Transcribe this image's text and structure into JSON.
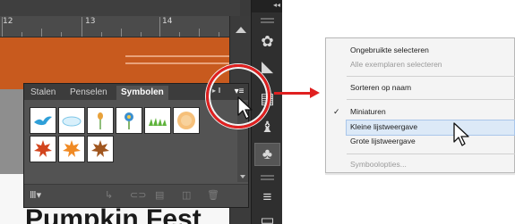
{
  "ruler": {
    "numbers": [
      "12",
      "13",
      "14"
    ]
  },
  "artwork": {
    "title": "Pumpkin Fest"
  },
  "dock": {
    "collapse_label": "◂◂",
    "buttons": [
      "brushes-icon",
      "gradient-icon",
      "transparency-icon",
      "graphic-styles-icon",
      "symbols-icon",
      "layers-icon"
    ]
  },
  "symbols_panel": {
    "tabs": [
      "Stalen",
      "Penselen",
      "Symbolen"
    ],
    "active_tab": "Symbolen",
    "symbols": [
      "blue-bird",
      "cloud",
      "flower-bud",
      "blue-flower",
      "grass",
      "sun-dots",
      "red-maple-leaf",
      "orange-maple-leaf",
      "brown-maple-leaf"
    ],
    "bottom_icons": [
      "symbol-libraries-icon",
      "place-symbol-icon",
      "break-link-icon",
      "symbol-options-icon",
      "new-symbol-icon",
      "delete-symbol-icon"
    ]
  },
  "context_menu": {
    "items": [
      {
        "label": "Ongebruikte selecteren",
        "enabled": true,
        "checked": false
      },
      {
        "label": "Alle exemplaren selecteren",
        "enabled": false,
        "checked": false
      },
      {
        "label": "Sorteren op naam",
        "enabled": true,
        "checked": false
      },
      {
        "label": "Miniaturen",
        "enabled": true,
        "checked": true
      },
      {
        "label": "Kleine lijstweergave",
        "enabled": true,
        "checked": false,
        "highlighted": true
      },
      {
        "label": "Grote lijstweergave",
        "enabled": true,
        "checked": false
      },
      {
        "label": "Symboolopties...",
        "enabled": false,
        "checked": false
      }
    ],
    "check_mark": "✓"
  },
  "colors": {
    "callout": "#e02020",
    "orange": "#c85a1e",
    "highlight": "#dce9f7"
  }
}
